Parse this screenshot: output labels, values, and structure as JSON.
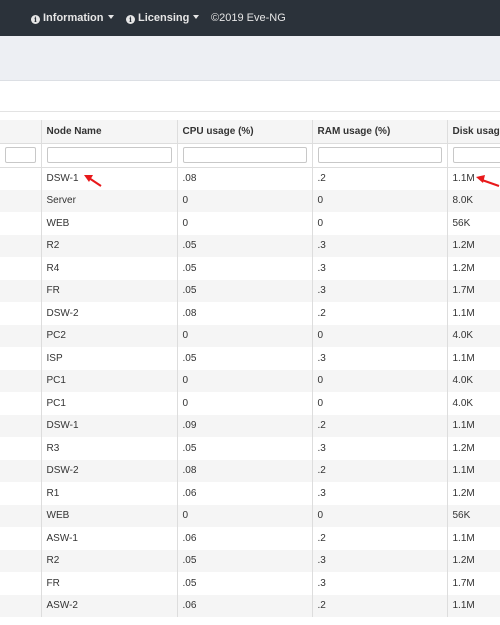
{
  "nav": {
    "information_label": "Information",
    "licensing_label": "Licensing",
    "copyright": "©2019 Eve-NG"
  },
  "table": {
    "columns": [
      "Node Name",
      "CPU usage (%)",
      "RAM usage (%)",
      "Disk usage"
    ],
    "rows": [
      [
        "DSW-1",
        ".08",
        ".2",
        "1.1M"
      ],
      [
        "Server",
        "0",
        "0",
        "8.0K"
      ],
      [
        "WEB",
        "0",
        "0",
        "56K"
      ],
      [
        "R2",
        ".05",
        ".3",
        "1.2M"
      ],
      [
        "R4",
        ".05",
        ".3",
        "1.2M"
      ],
      [
        "FR",
        ".05",
        ".3",
        "1.7M"
      ],
      [
        "DSW-2",
        ".08",
        ".2",
        "1.1M"
      ],
      [
        "PC2",
        "0",
        "0",
        "4.0K"
      ],
      [
        "ISP",
        ".05",
        ".3",
        "1.1M"
      ],
      [
        "PC1",
        "0",
        "0",
        "4.0K"
      ],
      [
        "PC1",
        "0",
        "0",
        "4.0K"
      ],
      [
        "DSW-1",
        ".09",
        ".2",
        "1.1M"
      ],
      [
        "R3",
        ".05",
        ".3",
        "1.2M"
      ],
      [
        "DSW-2",
        ".08",
        ".2",
        "1.1M"
      ],
      [
        "R1",
        ".06",
        ".3",
        "1.2M"
      ],
      [
        "WEB",
        "0",
        "0",
        "56K"
      ],
      [
        "ASW-1",
        ".06",
        ".2",
        "1.1M"
      ],
      [
        "R2",
        ".05",
        ".3",
        "1.2M"
      ],
      [
        "FR",
        ".05",
        ".3",
        "1.7M"
      ],
      [
        "ASW-2",
        ".06",
        ".2",
        "1.1M"
      ]
    ]
  },
  "colors": {
    "topbar": "#2b323a",
    "annotation_arrow": "#e8191b"
  }
}
